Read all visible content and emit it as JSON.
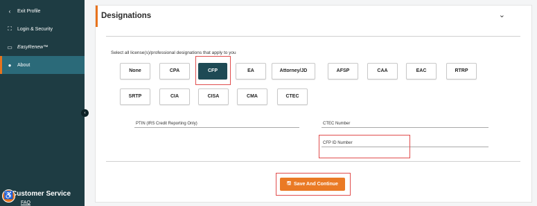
{
  "sidebar": {
    "items": [
      {
        "label": "Exit Profile",
        "icon": "chevron-left-icon",
        "glyph": "‹"
      },
      {
        "label": "Login & Security",
        "icon": "login-security-icon",
        "glyph": "⛶"
      },
      {
        "label": "EasyRenew™",
        "icon": "card-icon",
        "glyph": "▭"
      },
      {
        "label": "About",
        "icon": "user-icon",
        "glyph": "●"
      }
    ],
    "active": "About",
    "customer_service": "Customer Service",
    "faq": "FAQ",
    "collapse_glyph": "‹",
    "accessibility_glyph": "♿"
  },
  "section": {
    "title": "Designations",
    "chevron_glyph": "⌄",
    "instruction": "Select all license(s)/professional designations that apply to you",
    "designations_row1": [
      "None",
      "CPA",
      "CFP",
      "EA",
      "Attorney/JD",
      "AFSP",
      "CAA",
      "EAC",
      "RTRP"
    ],
    "designations_row2": [
      "SRTP",
      "CIA",
      "CISA",
      "CMA",
      "CTEC"
    ],
    "selected": "CFP",
    "fields": {
      "ptin": "PTIN (IRS Credit Reporting Only)",
      "ctec": "CTEC Number",
      "cfp_id": "CFP ID Number"
    },
    "save_label": "Save And Continue",
    "save_glyph": "🖫"
  },
  "colors": {
    "sidebar": "#1e3c43",
    "sidebar_active": "#2b6a79",
    "accent": "#e8731d",
    "selected_chip": "#1e4a55",
    "highlight": "#e04b4b"
  }
}
